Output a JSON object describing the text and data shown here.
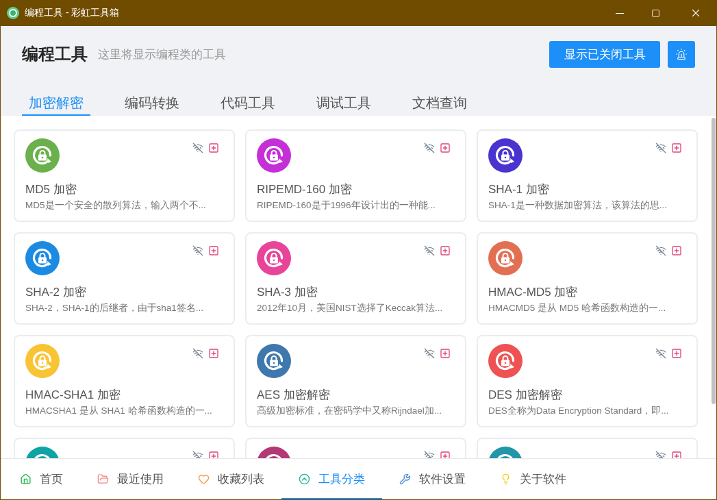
{
  "window": {
    "title": "编程工具 - 彩虹工具箱"
  },
  "header": {
    "title": "编程工具",
    "subtitle": "这里将显示编程类的工具",
    "show_closed_button": {
      "label": "显示已关闭工具"
    }
  },
  "tabs": [
    {
      "label": "加密解密",
      "selected": true
    },
    {
      "label": "编码转换",
      "selected": false
    },
    {
      "label": "代码工具",
      "selected": false
    },
    {
      "label": "调试工具",
      "selected": false
    },
    {
      "label": "文档查询",
      "selected": false
    }
  ],
  "tools": [
    {
      "title": "MD5 加密",
      "description": "MD5是一个安全的散列算法，输入两个不...",
      "color": "#6ab04c"
    },
    {
      "title": "RIPEMD-160 加密",
      "description": "RIPEMD-160是于1996年设计出的一种能...",
      "color": "#c42fd8"
    },
    {
      "title": "SHA-1 加密",
      "description": "SHA-1是一种数据加密算法，该算法的思...",
      "color": "#4a34d0"
    },
    {
      "title": "SHA-2 加密",
      "description": "SHA-2，SHA-1的后继者，由于sha1签名...",
      "color": "#1a8ae3"
    },
    {
      "title": "SHA-3 加密",
      "description": "2012年10月，美国NIST选择了Keccak算法...",
      "color": "#e8449a"
    },
    {
      "title": "HMAC-MD5 加密",
      "description": "HMACMD5 是从 MD5 哈希函数构造的一...",
      "color": "#e36f53"
    },
    {
      "title": "HMAC-SHA1 加密",
      "description": "HMACSHA1 是从 SHA1 哈希函数构造的一...",
      "color": "#f8c434"
    },
    {
      "title": "AES 加密解密",
      "description": "高级加密标准，在密码学中又称Rijndael加...",
      "color": "#3e78ad"
    },
    {
      "title": "DES 加密解密",
      "description": "DES全称为Data Encryption Standard，即...",
      "color": "#ee5253"
    },
    {
      "color": "#10a3a5"
    },
    {
      "color": "#b23876"
    },
    {
      "color": "#2196a8"
    }
  ],
  "bottom_nav": [
    {
      "label": "首页",
      "selected": false,
      "color": "#2bb550"
    },
    {
      "label": "最近使用",
      "selected": false,
      "color": "#f08a8a"
    },
    {
      "label": "收藏列表",
      "selected": false,
      "color": "#f0a050"
    },
    {
      "label": "工具分类",
      "selected": true,
      "color": "#20b89a"
    },
    {
      "label": "软件设置",
      "selected": false,
      "color": "#5b8ed8"
    },
    {
      "label": "关于软件",
      "selected": false,
      "color": "#f0d020"
    }
  ]
}
